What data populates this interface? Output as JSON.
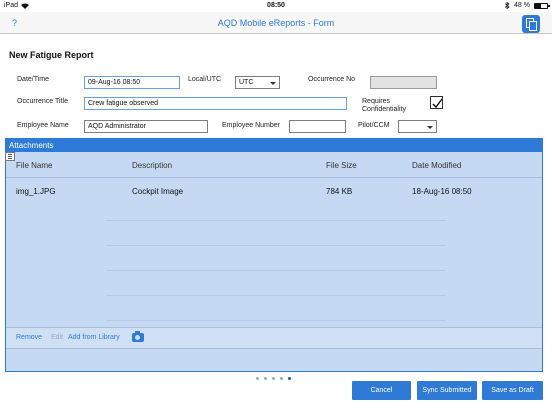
{
  "status_bar": {
    "device": "iPad",
    "time": "08:50",
    "battery": "48 %",
    "battery_level": 0.48
  },
  "nav": {
    "help": "?",
    "title": "AQD Mobile eReports - Form",
    "forms_icon": "documents-icon"
  },
  "form": {
    "title": "New Fatigue Report",
    "datetime_label": "Date/Time",
    "datetime_value": "09-Aug-16 08:50",
    "localutc_label": "Local/UTC",
    "localutc_value": "UTC",
    "occurrence_no_label": "Occurrence No",
    "occurrence_no_value": "",
    "occurrence_title_label": "Occurrence Title",
    "occurrence_title_value": "Crew fatigue observed",
    "requires_conf_label_1": "Requires",
    "requires_conf_label_2": "Confidentiality",
    "requires_conf_checked": true,
    "employee_name_label": "Employee Name",
    "employee_name_value": "AQD Administrator",
    "employee_number_label": "Employee Number",
    "employee_number_value": "",
    "pilot_ccm_label": "Pilot/CCM",
    "pilot_ccm_value": ""
  },
  "attachments": {
    "header": "Attachments",
    "columns": [
      "File Name",
      "Description",
      "File Size",
      "Date Modified"
    ],
    "rows": [
      {
        "file_name": "img_1.JPG",
        "description": "Cockpit Image",
        "file_size": "784 KB",
        "date_modified": "18-Aug-16 08:50"
      }
    ],
    "actions": {
      "remove": "Remove",
      "edit": "Edit",
      "add_from_library": "Add from Library",
      "camera_icon": "camera-icon"
    },
    "page_dots": 5,
    "active_dot": 4
  },
  "buttons": {
    "cancel": "Cancel",
    "sync_submitted": "Sync Submitted",
    "save_as_draft": "Save as Draft"
  },
  "colors": {
    "accent": "#2f7ad6",
    "grid_bg": "#c5d9f2"
  }
}
